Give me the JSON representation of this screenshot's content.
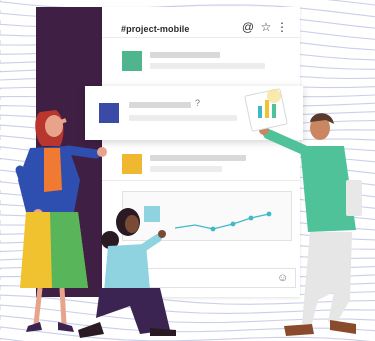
{
  "channel": {
    "title": "#project-mobile"
  },
  "header_icons": {
    "mention": "@",
    "star": "☆",
    "more": "⋮"
  },
  "message_card": {
    "help_glyph": "?"
  },
  "composer": {
    "emoji": "☺"
  },
  "colors": {
    "sidebar": "#3f1f43",
    "avatar_green": "#4fb58f",
    "avatar_blue": "#3b4aa6",
    "avatar_yellow": "#f0b731",
    "avatar_teal": "#8ed3df",
    "chart_line": "#41b8c8",
    "wave_lines": "#c9cfe8"
  },
  "icons": [
    "mention-icon",
    "star-icon",
    "more-options-icon",
    "emoji-icon"
  ]
}
